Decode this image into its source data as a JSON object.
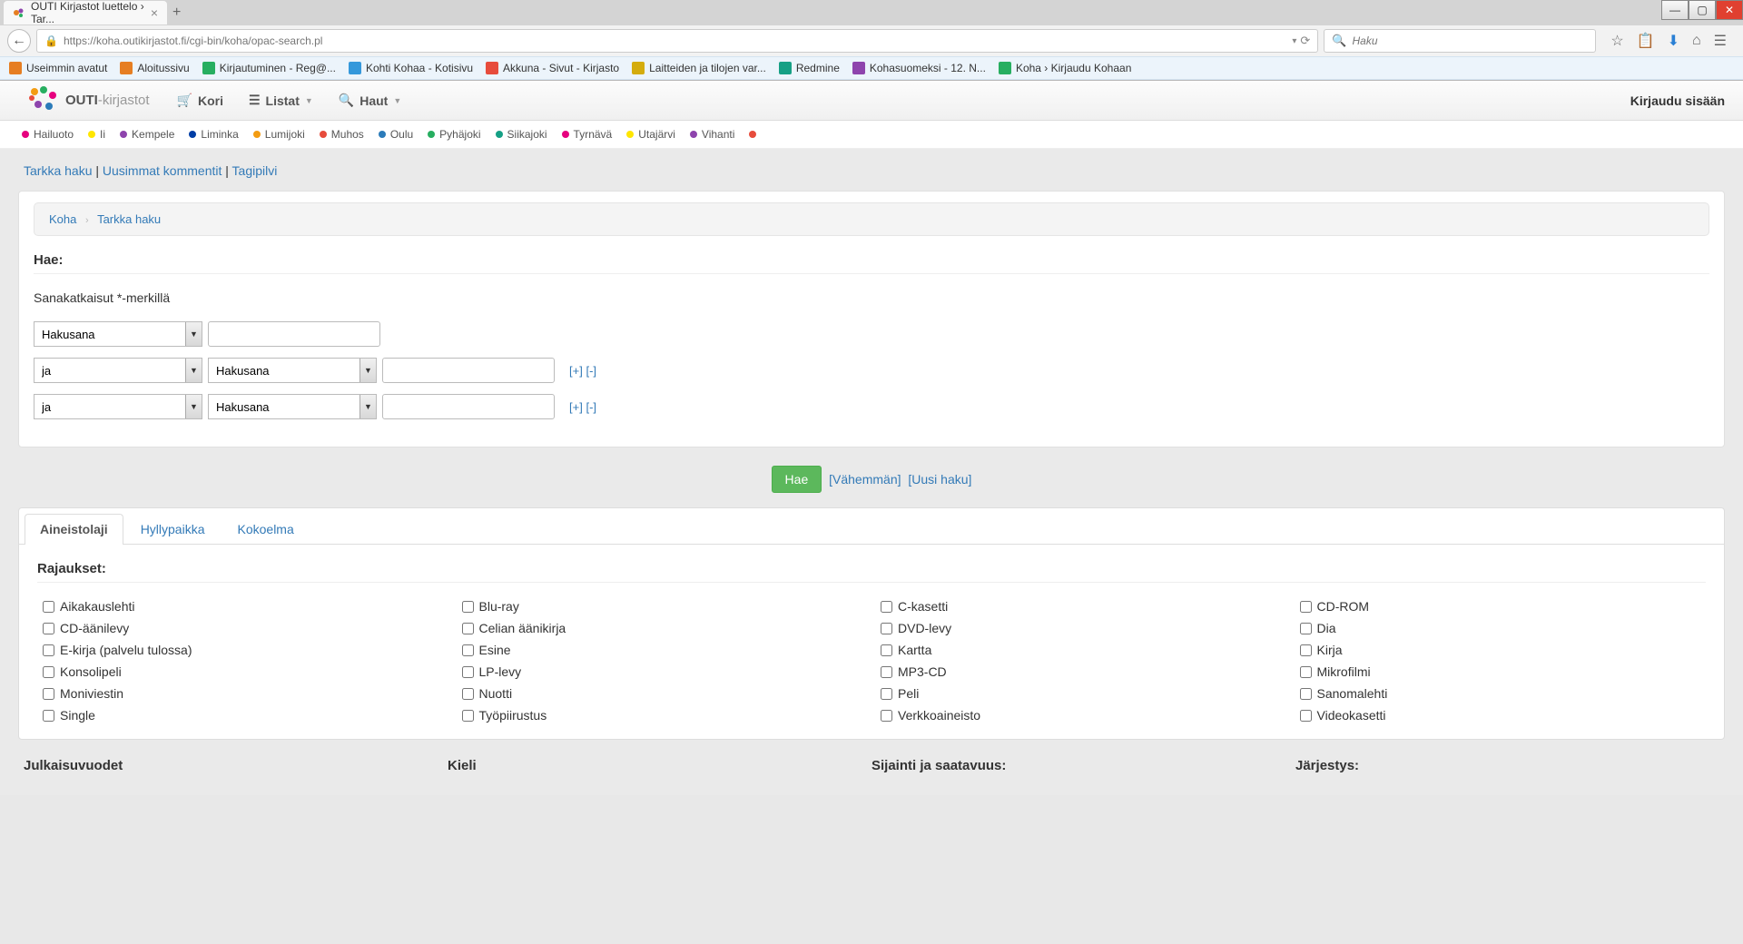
{
  "browser": {
    "tab_title": "OUTI Kirjastot luettelo › Tar...",
    "url": "https://koha.outikirjastot.fi/cgi-bin/koha/opac-search.pl",
    "search_placeholder": "Haku",
    "bookmarks": [
      {
        "label": "Useimmin avatut",
        "color": "#e67e22"
      },
      {
        "label": "Aloitussivu",
        "color": "#e67e22"
      },
      {
        "label": "Kirjautuminen - Reg@...",
        "color": "#27ae60"
      },
      {
        "label": "Kohti Kohaa - Kotisivu",
        "color": "#3498db"
      },
      {
        "label": "Akkuna - Sivut - Kirjasto",
        "color": "#e74c3c"
      },
      {
        "label": "Laitteiden ja tilojen var...",
        "color": "#d4ac0d"
      },
      {
        "label": "Redmine",
        "color": "#16a085"
      },
      {
        "label": "Kohasuomeksi - 12. N...",
        "color": "#8e44ad"
      },
      {
        "label": "Koha › Kirjaudu Kohaan",
        "color": "#27ae60"
      }
    ]
  },
  "header": {
    "logo_main": "OUTI",
    "logo_sub": "-kirjastot",
    "nav": {
      "kori": "Kori",
      "listat": "Listat",
      "haut": "Haut"
    },
    "login": "Kirjaudu sisään"
  },
  "locations": [
    {
      "name": "Hailuoto",
      "color": "#e6007e"
    },
    {
      "name": "Ii",
      "color": "#ffe600"
    },
    {
      "name": "Kempele",
      "color": "#8e44ad"
    },
    {
      "name": "Liminka",
      "color": "#003da5"
    },
    {
      "name": "Lumijoki",
      "color": "#f39c12"
    },
    {
      "name": "Muhos",
      "color": "#e74c3c"
    },
    {
      "name": "Oulu",
      "color": "#2b7bb9"
    },
    {
      "name": "Pyhäjoki",
      "color": "#27ae60"
    },
    {
      "name": "Siikajoki",
      "color": "#16a085"
    },
    {
      "name": "Tyrnävä",
      "color": "#e6007e"
    },
    {
      "name": "Utajärvi",
      "color": "#ffe600"
    },
    {
      "name": "Vihanti",
      "color": "#8e44ad"
    },
    {
      "name": "",
      "color": "#e74c3c"
    }
  ],
  "links_row": {
    "tarkka": "Tarkka haku",
    "uusimmat": "Uusimmat kommentit",
    "tagipilvi": "Tagipilvi"
  },
  "breadcrumb": {
    "home": "Koha",
    "current": "Tarkka haku"
  },
  "search": {
    "header": "Hae:",
    "hint": "Sanakatkaisut *-merkillä",
    "field_option": "Hakusana",
    "bool_option": "ja",
    "plus": "[+]",
    "minus": "[-]",
    "submit": "Hae",
    "fewer": "[Vähemmän]",
    "newsearch": "[Uusi haku]"
  },
  "tabs": {
    "aineistolaji": "Aineistolaji",
    "hyllypaikka": "Hyllypaikka",
    "kokoelma": "Kokoelma"
  },
  "limits": {
    "header": "Rajaukset:",
    "items": [
      "Aikakauslehti",
      "Blu-ray",
      "C-kasetti",
      "CD-ROM",
      "CD-äänilevy",
      "Celian äänikirja",
      "DVD-levy",
      "Dia",
      "E-kirja (palvelu tulossa)",
      "Esine",
      "Kartta",
      "Kirja",
      "Konsolipeli",
      "LP-levy",
      "MP3-CD",
      "Mikrofilmi",
      "Moniviestin",
      "Nuotti",
      "Peli",
      "Sanomalehti",
      "Single",
      "Työpiirustus",
      "Verkkoaineisto",
      "Videokasetti"
    ]
  },
  "bottom": {
    "julkaisuvuodet": "Julkaisuvuodet",
    "kieli": "Kieli",
    "sijainti": "Sijainti ja saatavuus:",
    "jarjestys": "Järjestys:"
  }
}
